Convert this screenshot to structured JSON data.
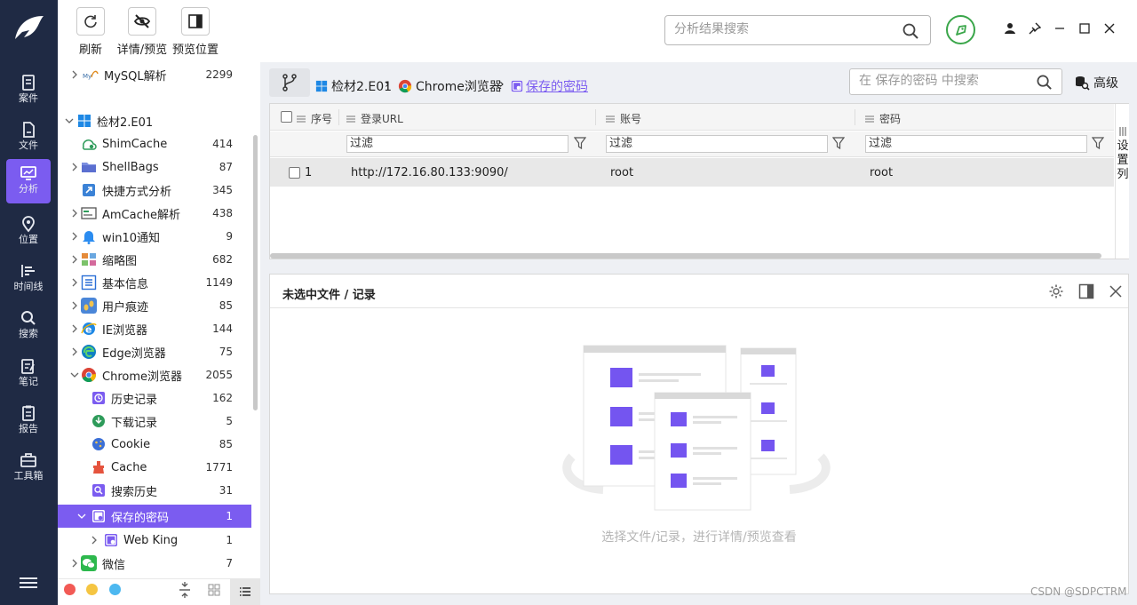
{
  "rail": {
    "items": [
      {
        "label": "案件"
      },
      {
        "label": "文件"
      },
      {
        "label": "分析"
      },
      {
        "label": "位置"
      },
      {
        "label": "时间线"
      },
      {
        "label": "搜索"
      },
      {
        "label": "笔记"
      },
      {
        "label": "报告"
      },
      {
        "label": "工具箱"
      }
    ]
  },
  "toolbar": {
    "refresh": "刷新",
    "details": "详情/预览",
    "preview_pos": "预览位置",
    "search_placeholder": "分析结果搜索"
  },
  "tree": {
    "items": [
      {
        "label": "MySQL解析",
        "count": "2299"
      },
      {
        "label": "检材2.E01",
        "count": ""
      },
      {
        "label": "ShimCache",
        "count": "414"
      },
      {
        "label": "ShellBags",
        "count": "87"
      },
      {
        "label": "快捷方式分析",
        "count": "345"
      },
      {
        "label": "AmCache解析",
        "count": "438"
      },
      {
        "label": "win10通知",
        "count": "9"
      },
      {
        "label": "缩略图",
        "count": "682"
      },
      {
        "label": "基本信息",
        "count": "1149"
      },
      {
        "label": "用户痕迹",
        "count": "85"
      },
      {
        "label": "IE浏览器",
        "count": "144"
      },
      {
        "label": "Edge浏览器",
        "count": "75"
      },
      {
        "label": "Chrome浏览器",
        "count": "2055"
      },
      {
        "label": "历史记录",
        "count": "162"
      },
      {
        "label": "下载记录",
        "count": "5"
      },
      {
        "label": "Cookie",
        "count": "85"
      },
      {
        "label": "Cache",
        "count": "1771"
      },
      {
        "label": "搜索历史",
        "count": "31"
      },
      {
        "label": "保存的密码",
        "count": "1"
      },
      {
        "label": "Web King",
        "count": "1"
      },
      {
        "label": "微信",
        "count": "7"
      }
    ]
  },
  "breadcrumb": {
    "c1": "检材2.E01",
    "c2": "Chrome浏览器",
    "c3": "保存的密码",
    "sep": "›",
    "search_placeholder": "在 保存的密码 中搜索",
    "advanced": "高级"
  },
  "grid": {
    "headers": [
      "序号",
      "登录URL",
      "账号",
      "密码"
    ],
    "filter_label": "过滤",
    "rows": [
      {
        "index": "1",
        "url": "http://172.16.80.133:9090/",
        "account": "root",
        "password": "root"
      }
    ],
    "set_columns": "设置列"
  },
  "detail": {
    "title": "未选中文件 / 记录",
    "empty_text": "选择文件/记录，进行详情/预览查看"
  },
  "watermark": "CSDN @SDPCTRM",
  "colors": {
    "accent": "#7b5cf0",
    "rail_bg": "#1f2a44",
    "green": "#3aa64a"
  }
}
